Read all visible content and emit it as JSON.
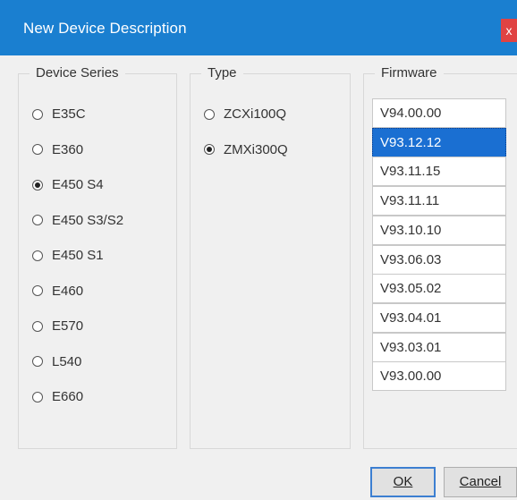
{
  "window": {
    "title": "New Device Description",
    "close_glyph": "x"
  },
  "device_series": {
    "label": "Device Series",
    "selected": "E450 S4",
    "options": [
      "E35C",
      "E360",
      "E450 S4",
      "E450 S3/S2",
      "E450 S1",
      "E460",
      "E570",
      "L540",
      "E660"
    ]
  },
  "type": {
    "label": "Type",
    "selected": "ZMXi300Q",
    "options": [
      "ZCXi100Q",
      "ZMXi300Q"
    ]
  },
  "firmware": {
    "label": "Firmware",
    "selected": "V93.12.12",
    "versions": [
      "V94.00.00",
      "V93.12.12",
      "V93.11.15",
      "V93.11.11",
      "V93.10.10",
      "V93.06.03",
      "V93.05.02",
      "V93.04.01",
      "V93.03.01",
      "V93.00.00"
    ]
  },
  "buttons": {
    "ok_label": "OK",
    "cancel_label": "Cancel"
  },
  "colors": {
    "titlebar": "#1a7fd0",
    "selection": "#1a6fd2",
    "close": "#e04343"
  }
}
